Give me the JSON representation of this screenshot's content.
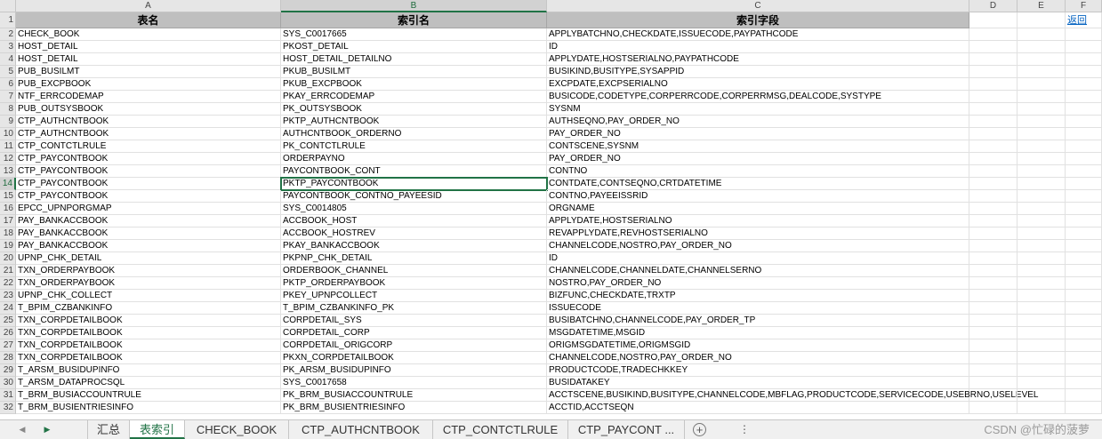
{
  "columns": [
    "A",
    "B",
    "C",
    "D",
    "E",
    "F"
  ],
  "header_row": {
    "row_number": "1",
    "a": "表名",
    "b": "索引名",
    "c": "索引字段",
    "f": "返回"
  },
  "rows": [
    {
      "n": "2",
      "a": "CHECK_BOOK",
      "b": "SYS_C0017665",
      "c": "APPLYBATCHNO,CHECKDATE,ISSUECODE,PAYPATHCODE"
    },
    {
      "n": "3",
      "a": "HOST_DETAIL",
      "b": "PKOST_DETAIL",
      "c": "ID"
    },
    {
      "n": "4",
      "a": "HOST_DETAIL",
      "b": "HOST_DETAIL_DETAILNO",
      "c": "APPLYDATE,HOSTSERIALNO,PAYPATHCODE"
    },
    {
      "n": "5",
      "a": "PUB_BUSILMT",
      "b": "PKUB_BUSILMT",
      "c": "BUSIKIND,BUSITYPE,SYSAPPID"
    },
    {
      "n": "6",
      "a": "PUB_EXCPBOOK",
      "b": "PKUB_EXCPBOOK",
      "c": "EXCPDATE,EXCPSERIALNO"
    },
    {
      "n": "7",
      "a": "NTF_ERRCODEMAP",
      "b": "PKAY_ERRCODEMAP",
      "c": "BUSICODE,CODETYPE,CORPERRCODE,CORPERRMSG,DEALCODE,SYSTYPE"
    },
    {
      "n": "8",
      "a": "PUB_OUTSYSBOOK",
      "b": "PK_OUTSYSBOOK",
      "c": "SYSNM"
    },
    {
      "n": "9",
      "a": "CTP_AUTHCNTBOOK",
      "b": "PKTP_AUTHCNTBOOK",
      "c": "AUTHSEQNO,PAY_ORDER_NO"
    },
    {
      "n": "10",
      "a": "CTP_AUTHCNTBOOK",
      "b": "AUTHCNTBOOK_ORDERNO",
      "c": "PAY_ORDER_NO"
    },
    {
      "n": "11",
      "a": "CTP_CONTCTLRULE",
      "b": "PK_CONTCTLRULE",
      "c": "CONTSCENE,SYSNM"
    },
    {
      "n": "12",
      "a": "CTP_PAYCONTBOOK",
      "b": "ORDERPAYNO",
      "c": "PAY_ORDER_NO"
    },
    {
      "n": "13",
      "a": "CTP_PAYCONTBOOK",
      "b": "PAYCONTBOOK_CONT",
      "c": "CONTNO"
    },
    {
      "n": "14",
      "a": "CTP_PAYCONTBOOK",
      "b": "PKTP_PAYCONTBOOK",
      "c": "CONTDATE,CONTSEQNO,CRTDATETIME"
    },
    {
      "n": "15",
      "a": "CTP_PAYCONTBOOK",
      "b": "PAYCONTBOOK_CONTNO_PAYEESID",
      "c": "CONTNO,PAYEEISSRID"
    },
    {
      "n": "16",
      "a": "EPCC_UPNPORGMAP",
      "b": "SYS_C0014805",
      "c": "ORGNAME"
    },
    {
      "n": "17",
      "a": "PAY_BANKACCBOOK",
      "b": "ACCBOOK_HOST",
      "c": "APPLYDATE,HOSTSERIALNO"
    },
    {
      "n": "18",
      "a": "PAY_BANKACCBOOK",
      "b": "ACCBOOK_HOSTREV",
      "c": "REVAPPLYDATE,REVHOSTSERIALNO"
    },
    {
      "n": "19",
      "a": "PAY_BANKACCBOOK",
      "b": "PKAY_BANKACCBOOK",
      "c": "CHANNELCODE,NOSTRO,PAY_ORDER_NO"
    },
    {
      "n": "20",
      "a": "UPNP_CHK_DETAIL",
      "b": "PKPNP_CHK_DETAIL",
      "c": "ID"
    },
    {
      "n": "21",
      "a": "TXN_ORDERPAYBOOK",
      "b": "ORDERBOOK_CHANNEL",
      "c": "CHANNELCODE,CHANNELDATE,CHANNELSERNO"
    },
    {
      "n": "22",
      "a": "TXN_ORDERPAYBOOK",
      "b": "PKTP_ORDERPAYBOOK",
      "c": "NOSTRO,PAY_ORDER_NO"
    },
    {
      "n": "23",
      "a": "UPNP_CHK_COLLECT",
      "b": "PKEY_UPNPCOLLECT",
      "c": "BIZFUNC,CHECKDATE,TRXTP"
    },
    {
      "n": "24",
      "a": "T_BPIM_CZBANKINFO",
      "b": "T_BPIM_CZBANKINFO_PK",
      "c": "ISSUECODE"
    },
    {
      "n": "25",
      "a": "TXN_CORPDETAILBOOK",
      "b": "CORPDETAIL_SYS",
      "c": "BUSIBATCHNO,CHANNELCODE,PAY_ORDER_TP"
    },
    {
      "n": "26",
      "a": "TXN_CORPDETAILBOOK",
      "b": "CORPDETAIL_CORP",
      "c": "MSGDATETIME,MSGID"
    },
    {
      "n": "27",
      "a": "TXN_CORPDETAILBOOK",
      "b": "CORPDETAIL_ORIGCORP",
      "c": "ORIGMSGDATETIME,ORIGMSGID"
    },
    {
      "n": "28",
      "a": "TXN_CORPDETAILBOOK",
      "b": "PKXN_CORPDETAILBOOK",
      "c": "CHANNELCODE,NOSTRO,PAY_ORDER_NO"
    },
    {
      "n": "29",
      "a": "T_ARSM_BUSIDUPINFO",
      "b": "PK_ARSM_BUSIDUPINFO",
      "c": "PRODUCTCODE,TRADECHKKEY"
    },
    {
      "n": "30",
      "a": "T_ARSM_DATAPROCSQL",
      "b": "SYS_C0017658",
      "c": "BUSIDATAKEY"
    },
    {
      "n": "31",
      "a": "T_BRM_BUSIACCOUNTRULE",
      "b": "PK_BRM_BUSIACCOUNTRULE",
      "c": "ACCTSCENE,BUSIKIND,BUSITYPE,CHANNELCODE,MBFLAG,PRODUCTCODE,SERVICECODE,USEBRNO,USELEVEL"
    },
    {
      "n": "32",
      "a": "T_BRM_BUSIENTRIESINFO",
      "b": "PK_BRM_BUSIENTRIESINFO",
      "c": "ACCTID,ACCTSEQN"
    }
  ],
  "selected_cell": {
    "row": "14",
    "col": "B"
  },
  "tabs": [
    {
      "label": "汇总",
      "active": false
    },
    {
      "label": "表索引",
      "active": true
    },
    {
      "label": "CHECK_BOOK",
      "active": false
    },
    {
      "label": "CTP_AUTHCNTBOOK",
      "active": false
    },
    {
      "label": "CTP_CONTCTLRULE",
      "active": false
    },
    {
      "label": "CTP_PAYCONT ...",
      "active": false
    }
  ],
  "tab_nav": {
    "prev": "◀",
    "next": "▶",
    "add": "+"
  },
  "watermark": "CSDN @忙碌的菠萝",
  "colors": {
    "accent": "#217346",
    "header_fill": "#bfbfbf",
    "link": "#0563c1"
  }
}
